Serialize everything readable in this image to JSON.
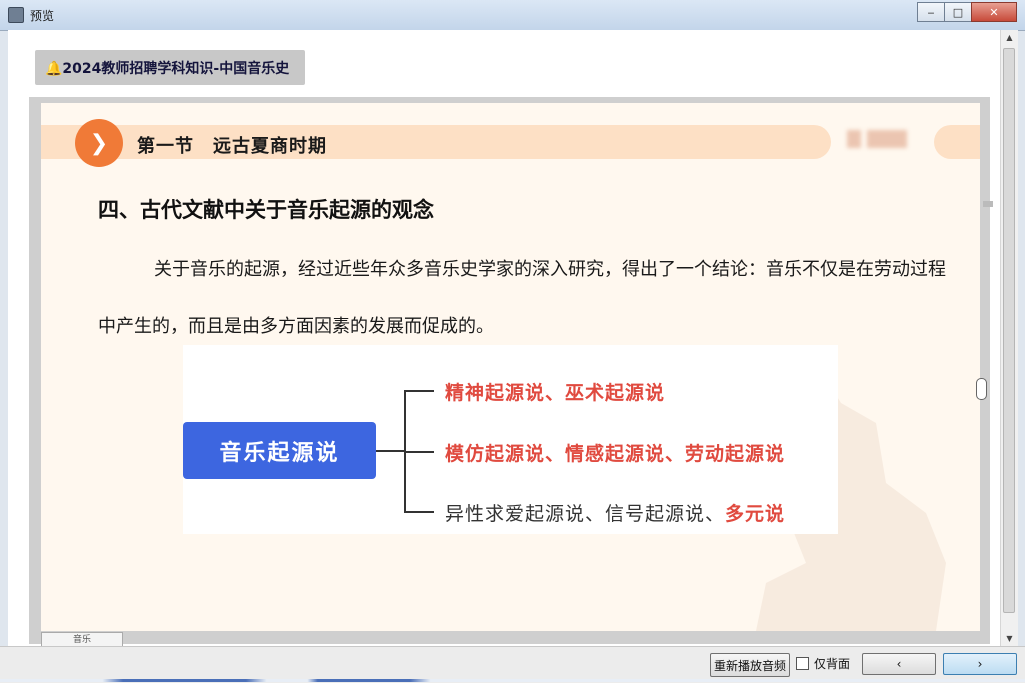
{
  "window": {
    "title": "预览",
    "minimize": "‒",
    "maximize": "□",
    "close": "✕"
  },
  "course_chip": "🔔2024教师招聘学科知识-中国音乐史",
  "slide": {
    "section_badge": "❯",
    "section_title": "第一节　远古夏商时期",
    "heading": "四、古代文献中关于音乐起源的观念",
    "paragraph": "关于音乐的起源，经过近些年众多音乐史学家的深入研究，得出了一个结论：音乐不仅是在劳动过程中产生的，而且是由多方面因素的发展而促成的。",
    "mindmap": {
      "root": "音乐起源说",
      "branch1": "精神起源说、巫术起源说",
      "branch2": "模仿起源说、情感起源说、劳动起源说",
      "branch3_plain": "异性求爱起源说、信号起源说、",
      "branch3_highlight": "多元说"
    }
  },
  "tab_stub": "音乐",
  "bottom": {
    "replay_button": "重新播放音频",
    "bg_only_label": "仅背面",
    "prev_button": "‹",
    "next_button": "›"
  },
  "colors": {
    "accent_orange": "#f07a37",
    "band_peach": "#fde0c5",
    "root_blue": "#3d66e0",
    "leaf_red": "#e04a3f"
  }
}
